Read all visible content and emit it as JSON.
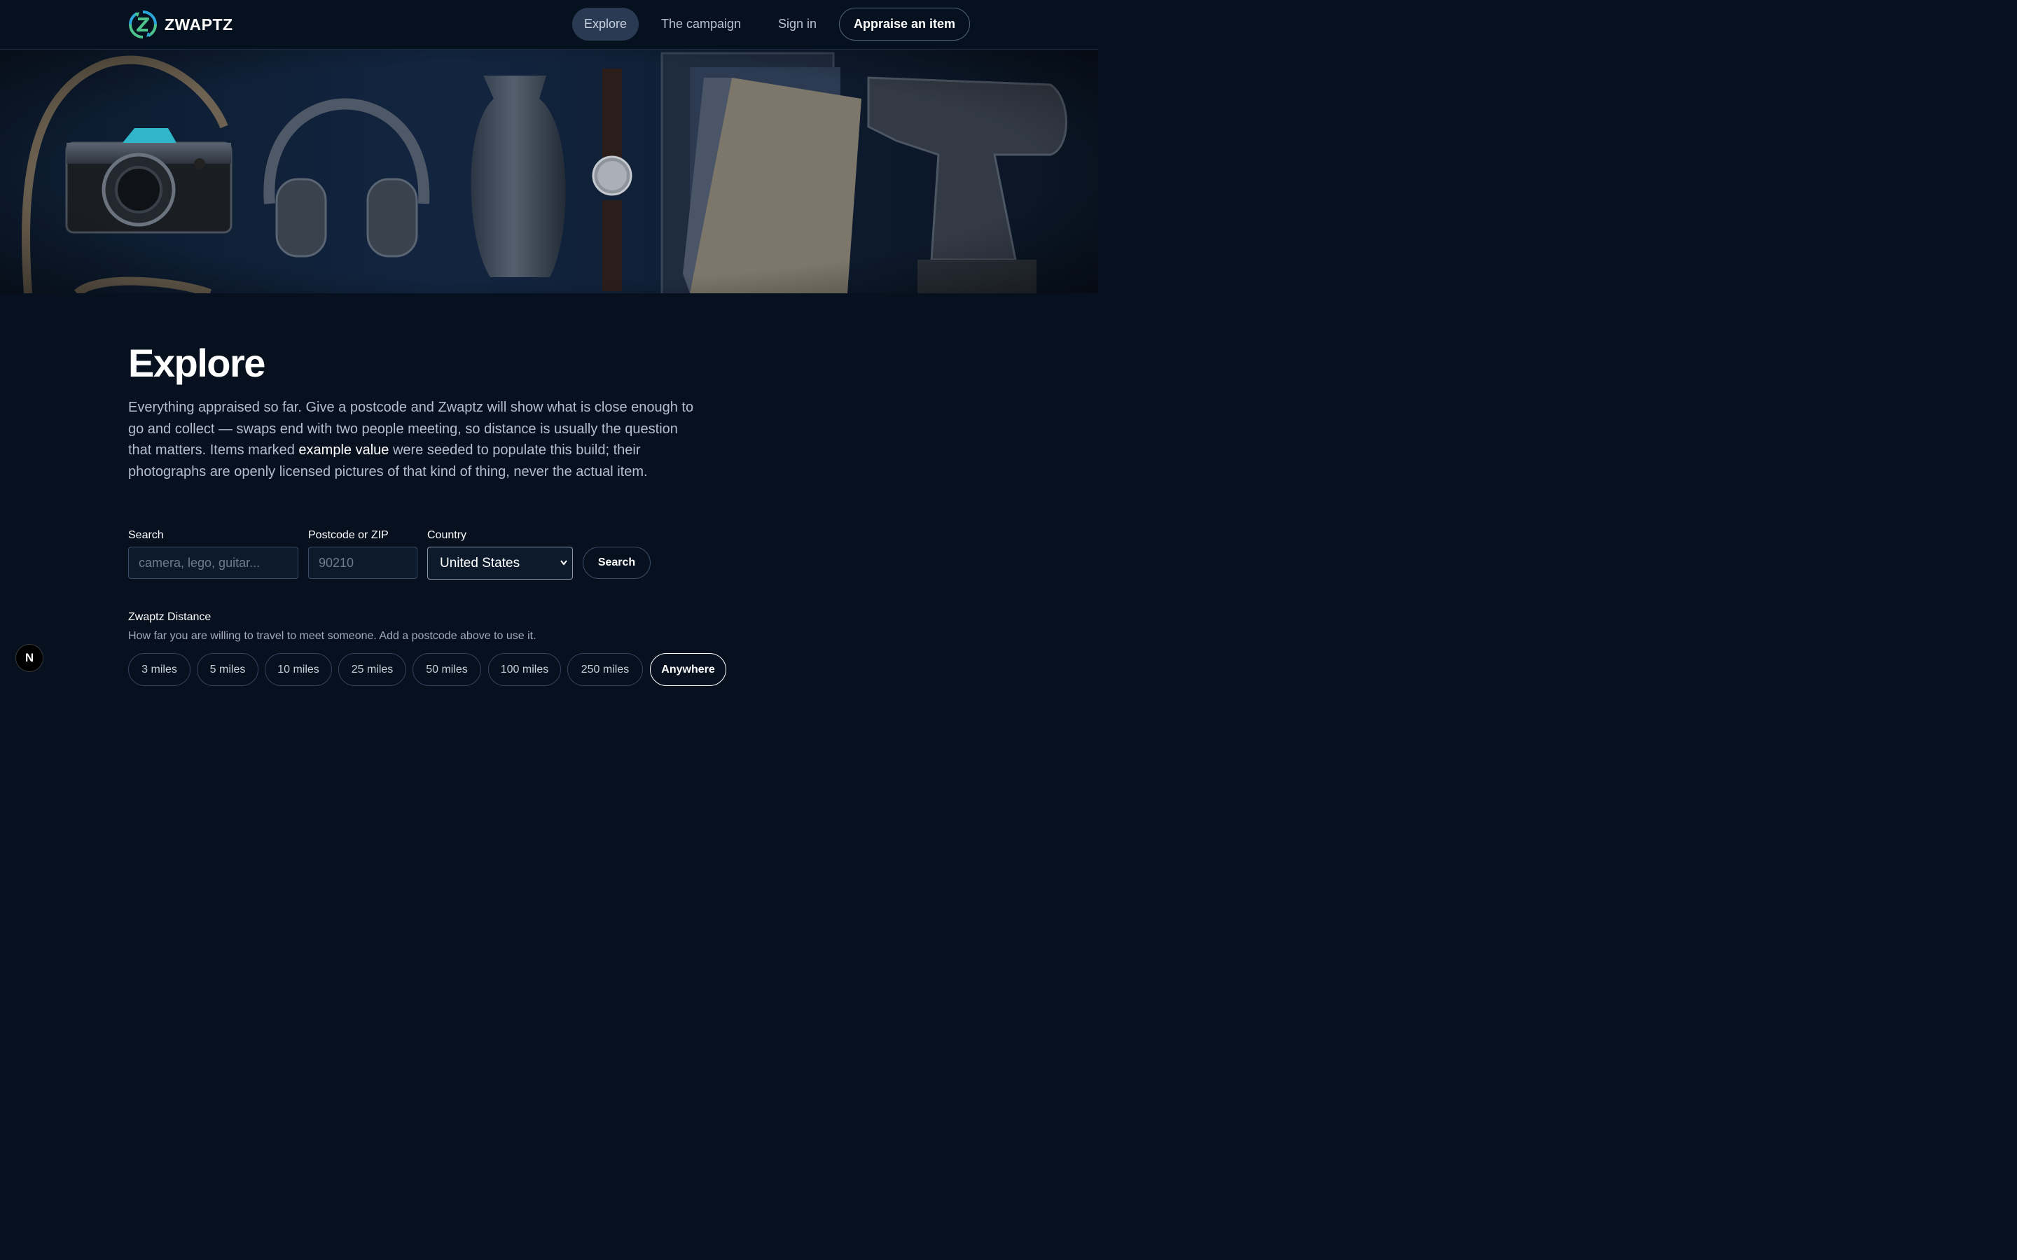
{
  "brand": {
    "name": "ZWAPTZ",
    "accent_green": "#4cc38a",
    "accent_blue": "#2aa7d8"
  },
  "nav": {
    "explore": "Explore",
    "campaign": "The campaign",
    "sign_in": "Sign in",
    "cta": "Appraise an item"
  },
  "hero": {
    "items": [
      "camera-icon",
      "headphones-icon",
      "vase-icon",
      "watch-icon",
      "book-icon",
      "drill-icon"
    ]
  },
  "page": {
    "title": "Explore",
    "intro_before": "Everything appraised so far. Give a postcode and Zwaptz will show what is close enough to go and collect — swaps end with two people meeting, so distance is usually the question that matters. Items marked ",
    "intro_highlight": "example value",
    "intro_after": " were seeded to populate this build; their photographs are openly licensed pictures of that kind of thing, never the actual item."
  },
  "search": {
    "search_label": "Search",
    "search_placeholder": "camera, lego, guitar...",
    "search_value": "",
    "postcode_label": "Postcode or ZIP",
    "postcode_placeholder": "90210",
    "postcode_value": "",
    "country_label": "Country",
    "country_value": "United States",
    "button": "Search"
  },
  "distance": {
    "title": "Zwaptz Distance",
    "help": "How far you are willing to travel to meet someone. Add a postcode above to use it.",
    "options": [
      "3 miles",
      "5 miles",
      "10 miles",
      "25 miles",
      "50 miles",
      "100 miles",
      "250 miles",
      "Anywhere"
    ],
    "selected": "Anywhere"
  },
  "badge": {
    "label": "N"
  }
}
